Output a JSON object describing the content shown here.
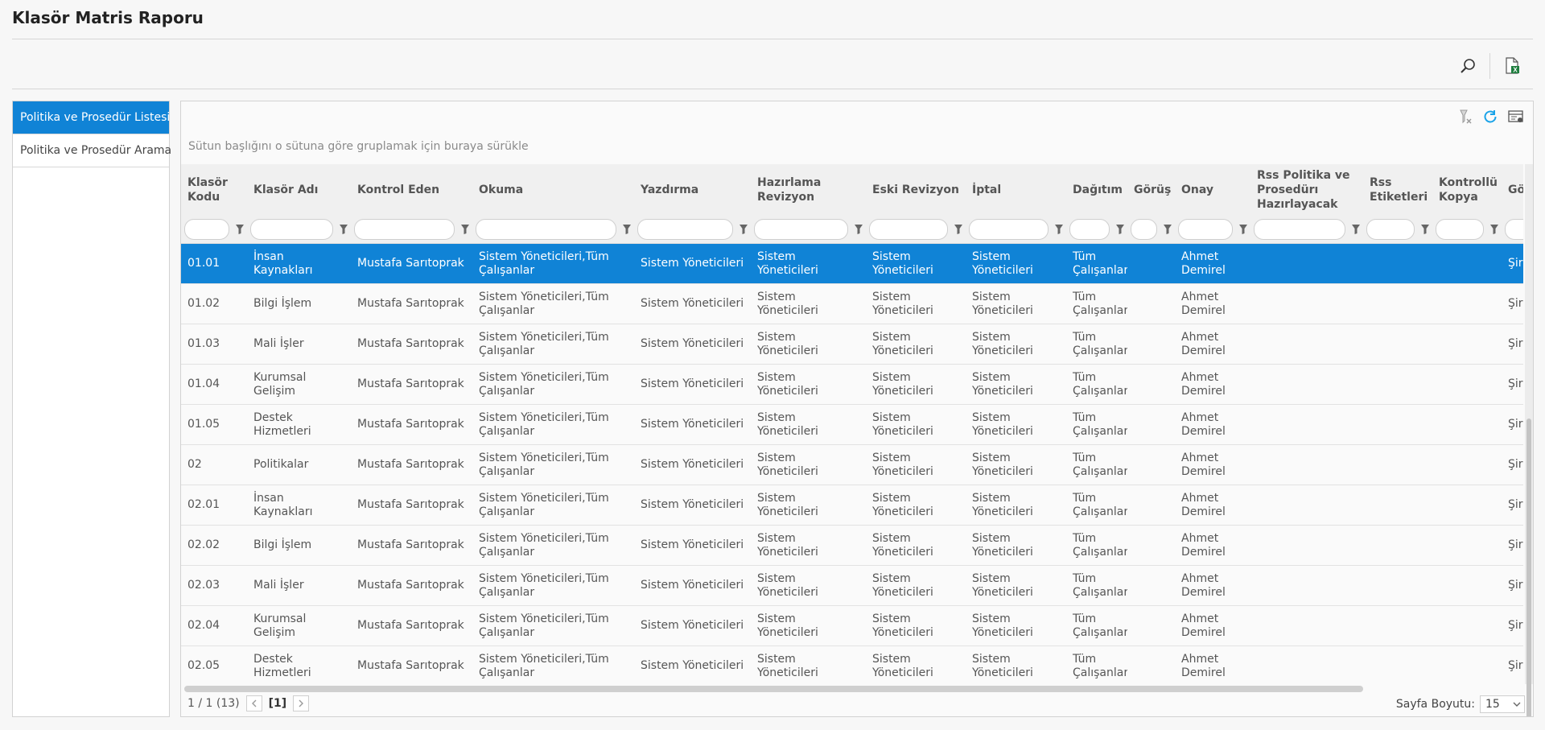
{
  "page": {
    "title": "Klasör Matris Raporu"
  },
  "toolbar": {
    "search_icon": "search-icon",
    "excel_icon": "excel-export-icon"
  },
  "sidebar": {
    "items": [
      {
        "label": "Politika ve Prosedür Listesi",
        "active": true
      },
      {
        "label": "Politika ve Prosedür Arama",
        "active": false
      }
    ]
  },
  "grid": {
    "tool_icons": [
      "clear-filter-icon",
      "refresh-icon",
      "column-settings-icon"
    ],
    "group_hint": "Sütun başlığını o sütuna göre gruplamak için buraya sürükle",
    "columns": [
      "Klasör Kodu",
      "Klasör Adı",
      "Kontrol Eden",
      "Okuma",
      "Yazdırma",
      "Hazırlama Revizyon",
      "Eski Revizyon",
      "İptal",
      "Dağıtım",
      "Görüş",
      "Onay",
      "Rss Politika ve Prosedürı Hazırlayacak",
      "Rss Etiketleri",
      "Kontrollü Kopya",
      "Gö"
    ],
    "rows": [
      {
        "cells": [
          "01.01",
          "İnsan Kaynakları",
          "Mustafa Sarıtoprak",
          "Sistem Yöneticileri,Tüm Çalışanlar",
          "Sistem Yöneticileri",
          "Sistem Yöneticileri",
          "Sistem Yöneticileri",
          "Sistem Yöneticileri",
          "Tüm Çalışanlar",
          "",
          "Ahmet Demirel",
          "",
          "",
          "",
          "Şir"
        ],
        "selected": true
      },
      {
        "cells": [
          "01.02",
          "Bilgi İşlem",
          "Mustafa Sarıtoprak",
          "Sistem Yöneticileri,Tüm Çalışanlar",
          "Sistem Yöneticileri",
          "Sistem Yöneticileri",
          "Sistem Yöneticileri",
          "Sistem Yöneticileri",
          "Tüm Çalışanlar",
          "",
          "Ahmet Demirel",
          "",
          "",
          "",
          "Şir"
        ],
        "selected": false
      },
      {
        "cells": [
          "01.03",
          "Mali İşler",
          "Mustafa Sarıtoprak",
          "Sistem Yöneticileri,Tüm Çalışanlar",
          "Sistem Yöneticileri",
          "Sistem Yöneticileri",
          "Sistem Yöneticileri",
          "Sistem Yöneticileri",
          "Tüm Çalışanlar",
          "",
          "Ahmet Demirel",
          "",
          "",
          "",
          "Şir"
        ],
        "selected": false
      },
      {
        "cells": [
          "01.04",
          "Kurumsal Gelişim",
          "Mustafa Sarıtoprak",
          "Sistem Yöneticileri,Tüm Çalışanlar",
          "Sistem Yöneticileri",
          "Sistem Yöneticileri",
          "Sistem Yöneticileri",
          "Sistem Yöneticileri",
          "Tüm Çalışanlar",
          "",
          "Ahmet Demirel",
          "",
          "",
          "",
          "Şir"
        ],
        "selected": false
      },
      {
        "cells": [
          "01.05",
          "Destek Hizmetleri",
          "Mustafa Sarıtoprak",
          "Sistem Yöneticileri,Tüm Çalışanlar",
          "Sistem Yöneticileri",
          "Sistem Yöneticileri",
          "Sistem Yöneticileri",
          "Sistem Yöneticileri",
          "Tüm Çalışanlar",
          "",
          "Ahmet Demirel",
          "",
          "",
          "",
          "Şir"
        ],
        "selected": false
      },
      {
        "cells": [
          "02",
          "Politikalar",
          "Mustafa Sarıtoprak",
          "Sistem Yöneticileri,Tüm Çalışanlar",
          "Sistem Yöneticileri",
          "Sistem Yöneticileri",
          "Sistem Yöneticileri",
          "Sistem Yöneticileri",
          "Tüm Çalışanlar",
          "",
          "Ahmet Demirel",
          "",
          "",
          "",
          "Şir"
        ],
        "selected": false
      },
      {
        "cells": [
          "02.01",
          "İnsan Kaynakları",
          "Mustafa Sarıtoprak",
          "Sistem Yöneticileri,Tüm Çalışanlar",
          "Sistem Yöneticileri",
          "Sistem Yöneticileri",
          "Sistem Yöneticileri",
          "Sistem Yöneticileri",
          "Tüm Çalışanlar",
          "",
          "Ahmet Demirel",
          "",
          "",
          "",
          "Şir"
        ],
        "selected": false
      },
      {
        "cells": [
          "02.02",
          "Bilgi İşlem",
          "Mustafa Sarıtoprak",
          "Sistem Yöneticileri,Tüm Çalışanlar",
          "Sistem Yöneticileri",
          "Sistem Yöneticileri",
          "Sistem Yöneticileri",
          "Sistem Yöneticileri",
          "Tüm Çalışanlar",
          "",
          "Ahmet Demirel",
          "",
          "",
          "",
          "Şir"
        ],
        "selected": false
      },
      {
        "cells": [
          "02.03",
          "Mali İşler",
          "Mustafa Sarıtoprak",
          "Sistem Yöneticileri,Tüm Çalışanlar",
          "Sistem Yöneticileri",
          "Sistem Yöneticileri",
          "Sistem Yöneticileri",
          "Sistem Yöneticileri",
          "Tüm Çalışanlar",
          "",
          "Ahmet Demirel",
          "",
          "",
          "",
          "Şir"
        ],
        "selected": false
      },
      {
        "cells": [
          "02.04",
          "Kurumsal Gelişim",
          "Mustafa Sarıtoprak",
          "Sistem Yöneticileri,Tüm Çalışanlar",
          "Sistem Yöneticileri",
          "Sistem Yöneticileri",
          "Sistem Yöneticileri",
          "Sistem Yöneticileri",
          "Tüm Çalışanlar",
          "",
          "Ahmet Demirel",
          "",
          "",
          "",
          "Şir"
        ],
        "selected": false
      },
      {
        "cells": [
          "02.05",
          "Destek Hizmetleri",
          "Mustafa Sarıtoprak",
          "Sistem Yöneticileri,Tüm Çalışanlar",
          "Sistem Yöneticileri",
          "Sistem Yöneticileri",
          "Sistem Yöneticileri",
          "Sistem Yöneticileri",
          "Tüm Çalışanlar",
          "",
          "Ahmet Demirel",
          "",
          "",
          "",
          "Şir"
        ],
        "selected": false
      }
    ]
  },
  "pager": {
    "info": "1 / 1 (13)",
    "current_page": "[1]",
    "page_size_label": "Sayfa Boyutu:",
    "page_size": "15"
  },
  "colors": {
    "accent": "#1083d6",
    "header_bg": "#f0f0f0"
  }
}
